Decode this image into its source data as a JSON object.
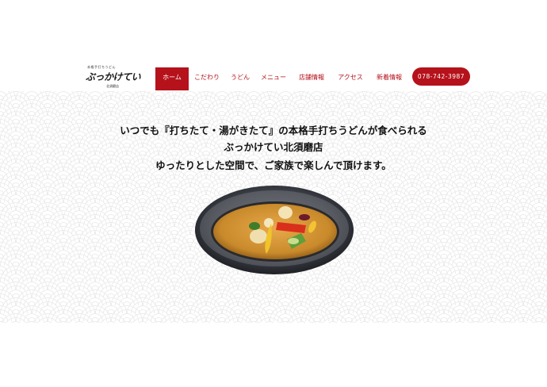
{
  "logo": {
    "tagline": "本格手打ちうどん",
    "brand": "ぶっかけてい",
    "branch": "北須磨店"
  },
  "nav": {
    "items": [
      {
        "label": "ホーム",
        "active": true
      },
      {
        "label": "こだわり"
      },
      {
        "label": "うどん"
      },
      {
        "label": "メニュー"
      },
      {
        "label": "店舗情報"
      },
      {
        "label": "アクセス"
      },
      {
        "label": "新着情報"
      }
    ],
    "phone": "078-742-3987"
  },
  "hero": {
    "line1": "いつでも『打ちたて・湯がきたて』の本格手打ちうどんが食べられる",
    "line2": "ぶっかけてい北須磨店",
    "line3": "ゆったりとした空間で、ご家族で楽しんで頂けます。"
  },
  "colors": {
    "accent": "#b5121b",
    "pattern": "#ececec"
  }
}
